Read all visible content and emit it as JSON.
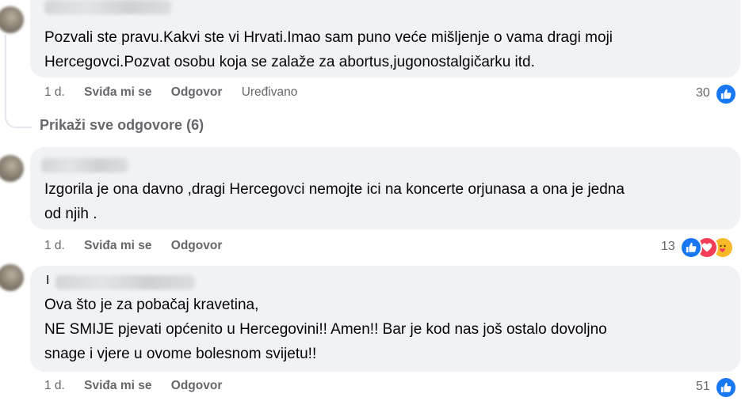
{
  "comments": [
    {
      "lines": [
        "Pozvali ste pravu.Kakvi ste vi Hrvati.Imao sam puno veće mišljenje o vama dragi moji",
        "Hercegovci.Pozvat osobu koja se zalaže za abortus,jugonostalgičarku itd."
      ],
      "time": "1 d.",
      "like_label": "Sviđa mi se",
      "reply_label": "Odgovor",
      "edited_label": "Uređivano",
      "reaction_count": "30",
      "reactions": [
        "like-icon"
      ]
    },
    {
      "lines": [
        "Izgorila je ona davno ,dragi Hercegovci nemojte ici na koncerte orjunasa a ona je jedna",
        "od njih ."
      ],
      "time": "1 d.",
      "like_label": "Sviđa mi se",
      "reply_label": "Odgovor",
      "reaction_count": "13",
      "reactions": [
        "like-icon",
        "love-icon",
        "care-icon"
      ]
    },
    {
      "name_fragment": "I",
      "lines": [
        "Ova što je za pobačaj kravetina,",
        "NE SMIJE pjevati općenito u Hercegovini!! Amen!! Bar je kod nas još ostalo dovoljno",
        "snage i vjere u ovome bolesnom svijetu!!"
      ],
      "time": "1 d.",
      "like_label": "Sviđa mi se",
      "reply_label": "Odgovor",
      "reaction_count": "51",
      "reactions": [
        "like-icon"
      ]
    }
  ],
  "show_replies_label": "Prikaži sve odgovore (6)",
  "colors": {
    "bubble": "#f0f2f5",
    "meta_text": "#65676b",
    "like": "#1877f2",
    "love": "#f33e58",
    "care": "#f7b928"
  }
}
